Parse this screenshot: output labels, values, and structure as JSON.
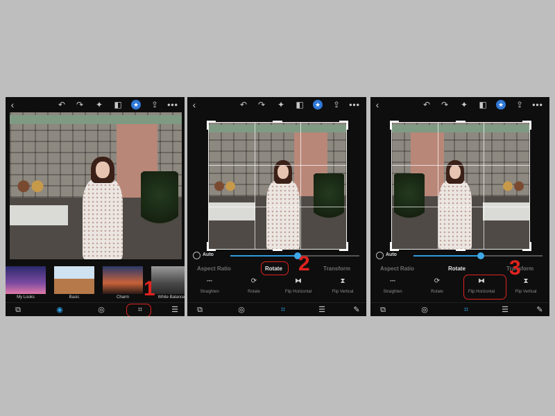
{
  "colors": {
    "accent": "#2f9de0",
    "annotation": "#e0231f",
    "panel_bg": "#0e0e0e",
    "page_bg": "#bebebe"
  },
  "icons": {
    "back": "‹",
    "undo": "↶",
    "redo": "↷",
    "magic": "✦",
    "compare": "◧",
    "star": "★",
    "share": "⇪",
    "more": "•••",
    "straighten": "⎓",
    "rotate": "⟳",
    "flip_horizontal": "⧓",
    "flip_vertical": "⧗",
    "nav_looks": "⧉",
    "nav_filter": "◉",
    "nav_blend": "◎",
    "nav_crop": "⌗",
    "nav_adjust": "☰",
    "nav_heal": "✎"
  },
  "panel1": {
    "presets": [
      {
        "label": "My Looks"
      },
      {
        "label": "Basic"
      },
      {
        "label": "Charm"
      },
      {
        "label": "White Balance"
      }
    ],
    "step": "1"
  },
  "panel2": {
    "auto_label": "Auto",
    "slider_value": 0.52,
    "tabs": {
      "aspect": "Aspect Ratio",
      "rotate": "Rotate",
      "transform": "Transform"
    },
    "tools": {
      "straighten": "Straighten",
      "rotate": "Rotate",
      "flip_horizontal": "Flip Horizontal",
      "flip_vertical": "Flip Vertical"
    },
    "step": "2"
  },
  "panel3": {
    "auto_label": "Auto",
    "slider_value": 0.52,
    "tabs": {
      "aspect": "Aspect Ratio",
      "rotate": "Rotate",
      "transform": "Transform"
    },
    "tools": {
      "straighten": "Straighten",
      "rotate": "Rotate",
      "flip_horizontal": "Flip Horizontal",
      "flip_vertical": "Flip Vertical"
    },
    "step": "3"
  }
}
